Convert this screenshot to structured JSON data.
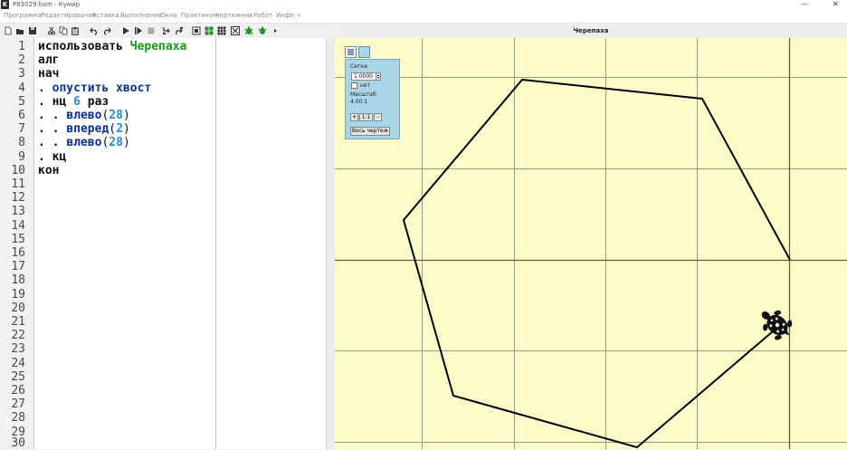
{
  "window": {
    "title": "P83029.kum - Кумир",
    "app_icon_letter": "K",
    "minimize_glyph": "—",
    "close_glyph": "✕"
  },
  "menu": {
    "items": [
      "Программа",
      "Редактирование",
      "Вставка",
      "Выполнение",
      "Окна",
      "Практикум",
      "Чертежник",
      "Робот",
      "Инфо",
      "»"
    ]
  },
  "editor": {
    "line_numbers": [
      "1",
      "2",
      "3",
      "4",
      "5",
      "6",
      "7",
      "8",
      "9",
      "10",
      "11",
      "12",
      "13",
      "14",
      "15",
      "16",
      "17",
      "18",
      "19",
      "20",
      "21",
      "22",
      "23",
      "24",
      "25",
      "26",
      "27",
      "28",
      "29",
      "30"
    ],
    "code": {
      "l1_kw": "использовать",
      "l1_name": "Черепаха",
      "l2": "алг",
      "l3": "нач",
      "l4_dot": ". ",
      "l4_cmd": "опустить хвост",
      "l5_dot": ". ",
      "l5_kw": "нц",
      "l5_num": "6",
      "l5_kw2": "раз",
      "l6_dots": ". . ",
      "l6_cmd": "влево",
      "l6_num": "28",
      "l7_dots": ". . ",
      "l7_cmd": "вперед",
      "l7_num": "2",
      "l8_dots": ". . ",
      "l8_cmd": "влево",
      "l8_num": "28",
      "l9_dot": ". ",
      "l9_kw": "кц",
      "l10": "кон",
      "paren_open": "(",
      "paren_close": ")"
    }
  },
  "turtle_window": {
    "title": "Черепаха"
  },
  "grid_panel": {
    "grid_label": "Сетка:",
    "grid_value": "1.0000",
    "grid_checkbox_label": "нет",
    "scale_label": "Масштаб:",
    "scale_value": "4.00:1",
    "zoom_in": "+",
    "zoom_reset": "1:1",
    "zoom_out": "-",
    "fit_all": "Весь чертеж"
  },
  "colors": {
    "canvas_bg": "#fcfcc8",
    "grid_line": "#9c9c7c",
    "axis_line": "#6b5a3a",
    "path": "#000000",
    "keyword_blue": "#0b2fa0",
    "module_green": "#14a014",
    "number_blue": "#1e8fe0",
    "panel_bg": "#a9d6e6"
  },
  "icons": [
    "new-file-icon",
    "open-file-icon",
    "save-icon",
    "cut-icon",
    "copy-icon",
    "paste-icon",
    "undo-icon",
    "redo-icon",
    "run-icon",
    "step-run-icon",
    "stop-icon",
    "step-in-icon",
    "step-out-icon",
    "window-icon",
    "grid-icon",
    "grid2-icon",
    "robot-icon",
    "turtle-tool-icon",
    "turtle-tool2-icon",
    "more-icon"
  ]
}
